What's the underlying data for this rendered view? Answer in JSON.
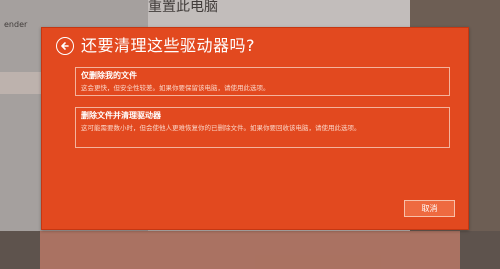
{
  "background": {
    "window_title": "重置此电脑",
    "left_pane_text": "ender"
  },
  "dialog": {
    "title": "还要清理这些驱动器吗?",
    "back_icon": "back-arrow-icon",
    "options": [
      {
        "title": "仅删除我的文件",
        "description": "这会更快，但安全性较差。如果你要保留该电脑，请使用此选项。"
      },
      {
        "title": "删除文件并清理驱动器",
        "description": "这可能需要数小时，但会使他人更难恢复你的已删除文件。如果你要回收该电脑，请使用此选项。"
      }
    ],
    "cancel_label": "取消"
  },
  "colors": {
    "dialog_accent": "#e2491f",
    "dialog_border": "#f4b39c",
    "text": "#ffffff"
  }
}
